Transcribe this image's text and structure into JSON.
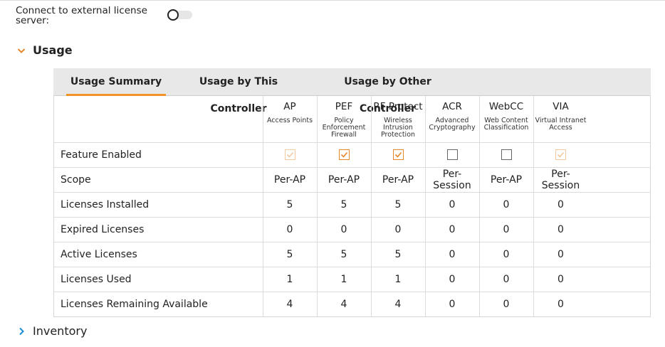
{
  "external_server": {
    "label": "Connect to external license server:",
    "toggle_on": false
  },
  "sections": {
    "usage_title": "Usage",
    "inventory_title": "Inventory"
  },
  "tabs": [
    {
      "label": "Usage Summary",
      "active": true
    },
    {
      "label": "Usage by This Controller",
      "active": false
    },
    {
      "label": "Usage by Other Controller",
      "active": false
    }
  ],
  "table": {
    "columns": [
      {
        "abbr": "AP",
        "desc": [
          "Access Points"
        ]
      },
      {
        "abbr": "PEF",
        "desc": [
          "Policy",
          "Enforcement",
          "Firewall"
        ]
      },
      {
        "abbr": "RF Protect",
        "desc": [
          "Wireless",
          "Intrusion",
          "Protection"
        ]
      },
      {
        "abbr": "ACR",
        "desc": [
          "Advanced",
          "Cryptography"
        ]
      },
      {
        "abbr": "WebCC",
        "desc": [
          "Web Content",
          "Classification"
        ]
      },
      {
        "abbr": "VIA",
        "desc": [
          "Virtual Intranet",
          "Access"
        ]
      }
    ],
    "feature_enabled": {
      "label": "Feature Enabled",
      "values": [
        {
          "checked": true,
          "disabled": true
        },
        {
          "checked": true,
          "disabled": false
        },
        {
          "checked": true,
          "disabled": false
        },
        {
          "checked": false,
          "disabled": false
        },
        {
          "checked": false,
          "disabled": false
        },
        {
          "checked": true,
          "disabled": true
        }
      ]
    },
    "rows": [
      {
        "label": "Scope",
        "values": [
          "Per-AP",
          "Per-AP",
          "Per-AP",
          "Per-Session",
          "Per-AP",
          "Per-Session"
        ]
      },
      {
        "label": "Licenses Installed",
        "values": [
          "5",
          "5",
          "5",
          "0",
          "0",
          "0"
        ]
      },
      {
        "label": "Expired Licenses",
        "values": [
          "0",
          "0",
          "0",
          "0",
          "0",
          "0"
        ]
      },
      {
        "label": "Active Licenses",
        "values": [
          "5",
          "5",
          "5",
          "0",
          "0",
          "0"
        ]
      },
      {
        "label": "Licenses Used",
        "values": [
          "1",
          "1",
          "1",
          "0",
          "0",
          "0"
        ]
      },
      {
        "label": "Licenses Remaining Available",
        "values": [
          "4",
          "4",
          "4",
          "0",
          "0",
          "0"
        ]
      }
    ]
  },
  "colors": {
    "accent": "#f39226",
    "tabbar_bg": "#e8e8e8",
    "chevron_expanded": "#e8872a",
    "chevron_collapsed": "#1a8fd6"
  },
  "icons": {
    "usage_chevron": "chevron-down-icon",
    "inventory_chevron": "chevron-right-icon",
    "checkbox_check": "checkmark-icon"
  }
}
